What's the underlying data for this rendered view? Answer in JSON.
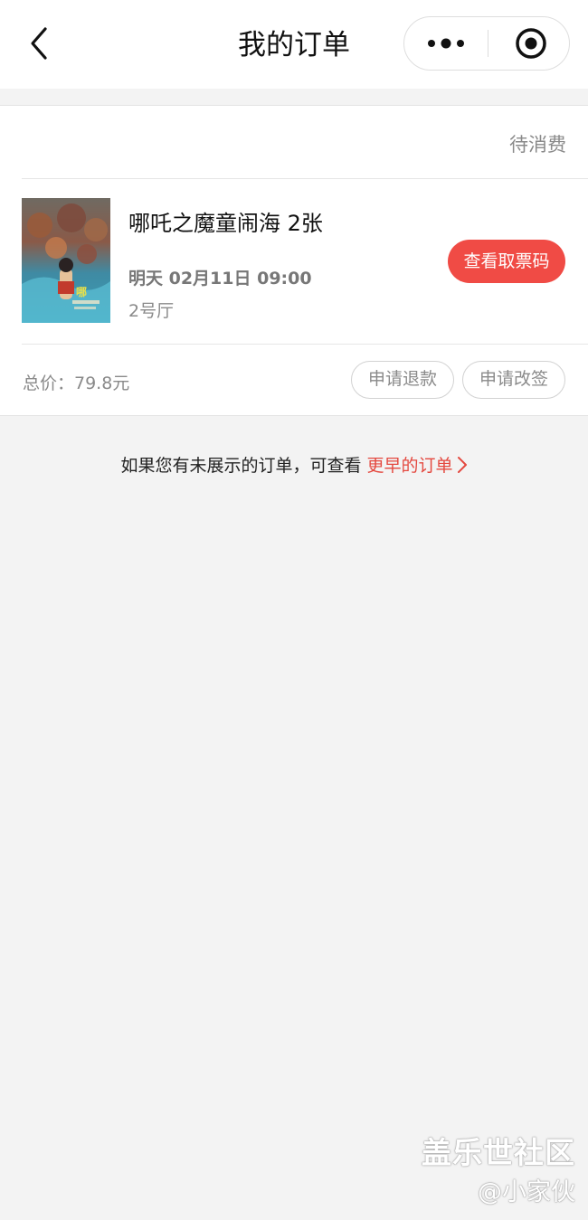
{
  "nav": {
    "title": "我的订单"
  },
  "order": {
    "status": "待消费",
    "movie_title": "哪吒之魔童闹海 2张",
    "show_time": "明天 02月11日 09:00",
    "hall": "2号厅",
    "view_ticket_label": "查看取票码",
    "total_price": "总价：79.8元",
    "refund_label": "申请退款",
    "change_label": "申请改签"
  },
  "hint": {
    "text": "如果您有未展示的订单，可查看",
    "link": "更早的订单"
  },
  "watermark": {
    "line1": "盖乐世社区",
    "line2": "@小家伙"
  },
  "colors": {
    "accent": "#f04b45",
    "link": "#e4483f",
    "background": "#f3f3f3"
  }
}
